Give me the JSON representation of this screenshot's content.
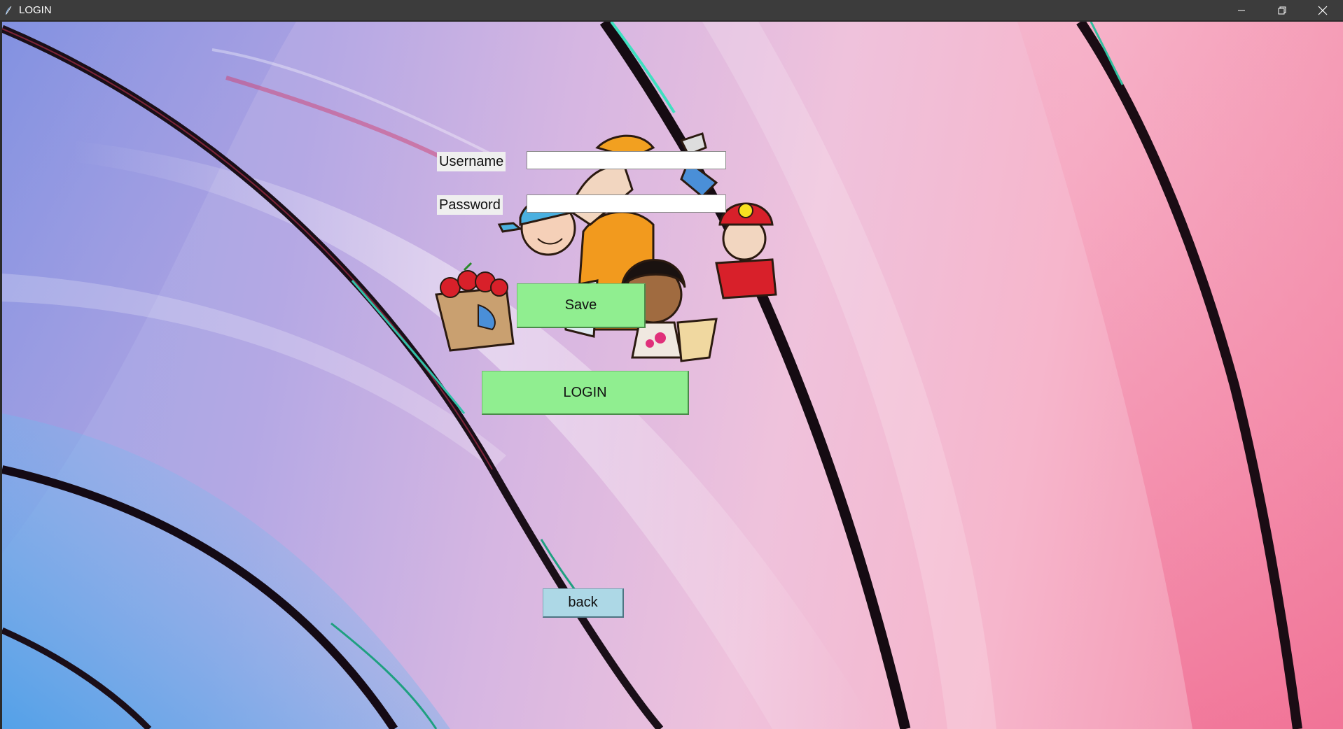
{
  "window": {
    "title": "LOGIN",
    "controls": {
      "minimize_icon": "minimize-icon",
      "maximize_icon": "restore-icon",
      "close_icon": "close-icon"
    },
    "titlebar_color": "#3c3c3c"
  },
  "form": {
    "username_label": "Username",
    "username_value": "",
    "password_label": "Password",
    "password_value": "",
    "save_label": "Save",
    "login_label": "LOGIN",
    "back_label": "back"
  },
  "colors": {
    "green_button": "#90ee90",
    "blue_button": "#add8e6"
  },
  "illustration": "community-workers-clipart"
}
